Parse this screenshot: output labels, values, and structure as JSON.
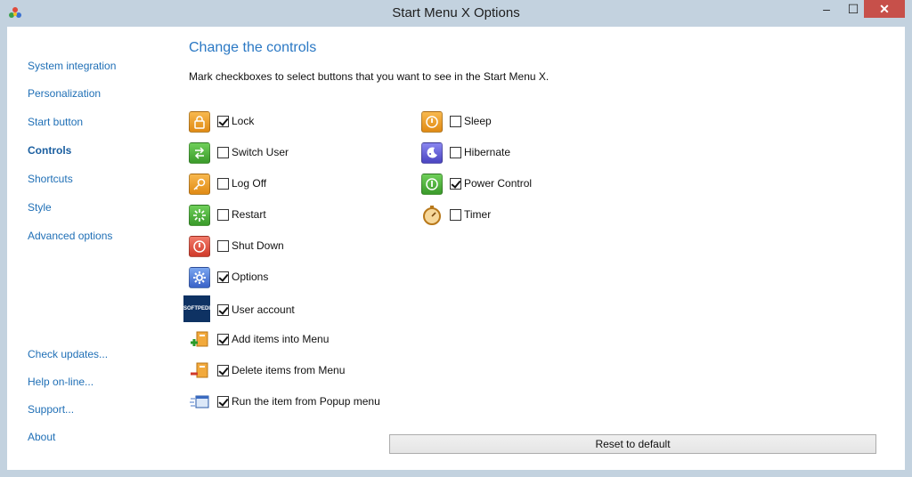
{
  "window": {
    "title": "Start Menu X Options",
    "minimize": "–",
    "maximize": "☐",
    "close": "✕"
  },
  "nav": {
    "top": [
      "System integration",
      "Personalization",
      "Start button",
      "Controls",
      "Shortcuts",
      "Style",
      "Advanced options"
    ],
    "bottom": [
      "Check updates...",
      "Help on-line...",
      "Support...",
      "About"
    ],
    "active": "Controls"
  },
  "main": {
    "heading": "Change the controls",
    "description": "Mark checkboxes to select buttons that you want to see in the Start Menu X.",
    "controls_left": [
      {
        "label": "Lock",
        "checked": true,
        "icon": "lock-icon"
      },
      {
        "label": "Switch User",
        "checked": false,
        "icon": "switch-user-icon"
      },
      {
        "label": "Log Off",
        "checked": false,
        "icon": "key-icon"
      },
      {
        "label": "Restart",
        "checked": false,
        "icon": "restart-icon"
      },
      {
        "label": "Shut Down",
        "checked": false,
        "icon": "power-icon"
      },
      {
        "label": "Options",
        "checked": true,
        "icon": "gear-icon"
      },
      {
        "label": "User account",
        "checked": true,
        "icon": "softpedia-avatar-icon",
        "icon_text": "SOFTPEDIA"
      },
      {
        "label": "Add items into Menu",
        "checked": true,
        "icon": "add-item-icon"
      },
      {
        "label": "Delete items from Menu",
        "checked": true,
        "icon": "delete-item-icon"
      },
      {
        "label": "Run the item from Popup menu",
        "checked": true,
        "icon": "popup-window-icon"
      }
    ],
    "controls_right": [
      {
        "label": "Sleep",
        "checked": false,
        "icon": "sleep-icon"
      },
      {
        "label": "Hibernate",
        "checked": false,
        "icon": "hibernate-icon"
      },
      {
        "label": "Power Control",
        "checked": true,
        "icon": "power-control-icon"
      },
      {
        "label": "Timer",
        "checked": false,
        "icon": "stopwatch-icon"
      }
    ],
    "reset_label": "Reset to default"
  },
  "colors": {
    "accent": "#2a78c4",
    "nav_link": "#1f6fb6",
    "frame": "#c3d2df",
    "close_button": "#c7504a"
  }
}
